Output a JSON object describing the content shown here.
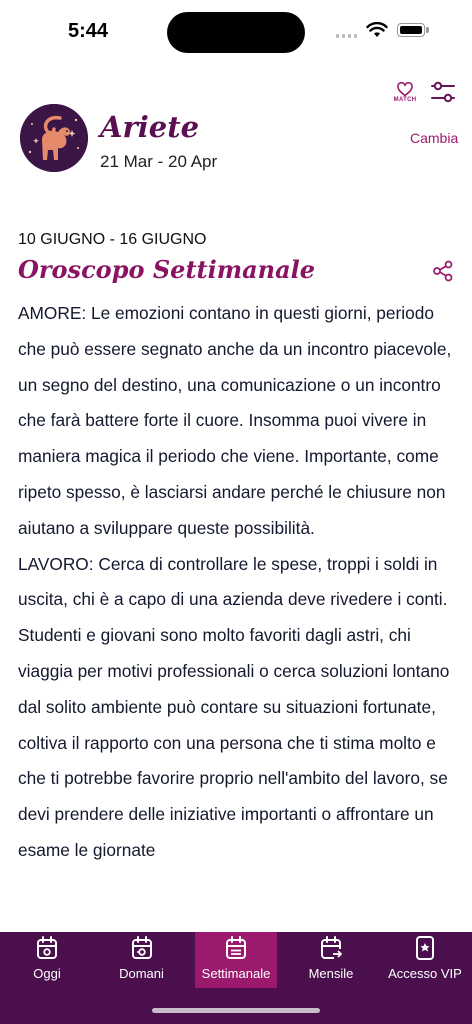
{
  "status_bar": {
    "time": "5:44"
  },
  "header": {
    "match_label": "MATCH",
    "sign_name": "Ariete",
    "sign_dates": "21 Mar - 20 Apr",
    "change_link": "Cambia"
  },
  "content": {
    "week_range": "10 GIUGNO - 16 GIUGNO",
    "title": "Oroscopo Settimanale",
    "paragraphs": [
      "AMORE: Le emozioni contano in questi giorni, periodo che può essere segnato anche da un incontro piacevole, un segno del destino, una comunicazione o un incontro che farà battere forte il cuore. Insomma puoi vivere in maniera magica il periodo che viene. Importante, come ripeto spesso, è lasciarsi andare perché le chiusure non aiutano a sviluppare queste possibilità.",
      "LAVORO: Cerca di controllare le spese, troppi i soldi in uscita, chi è a capo di una azienda deve rivedere i conti. Studenti e giovani sono molto favoriti dagli astri, chi viaggia per motivi professionali o cerca soluzioni lontano dal solito ambiente può contare su situazioni fortunate, coltiva il rapporto con una persona che ti stima molto e che ti potrebbe favorire proprio nell'ambito del lavoro, se devi prendere delle iniziative importanti o affrontare un esame le giornate"
    ]
  },
  "tabs": [
    {
      "label": "Oggi",
      "icon": "calendar-day-icon",
      "active": false
    },
    {
      "label": "Domani",
      "icon": "calendar-next-icon",
      "active": false
    },
    {
      "label": "Settimanale",
      "icon": "calendar-week-icon",
      "active": true
    },
    {
      "label": "Mensile",
      "icon": "calendar-arrow-icon",
      "active": false
    },
    {
      "label": "Accesso VIP",
      "icon": "vip-card-icon",
      "active": false
    }
  ],
  "colors": {
    "brand_purple": "#5a0f52",
    "accent_magenta": "#9c1a6e",
    "tab_bar_bg": "#4a0f4c",
    "text": "#14192f"
  }
}
